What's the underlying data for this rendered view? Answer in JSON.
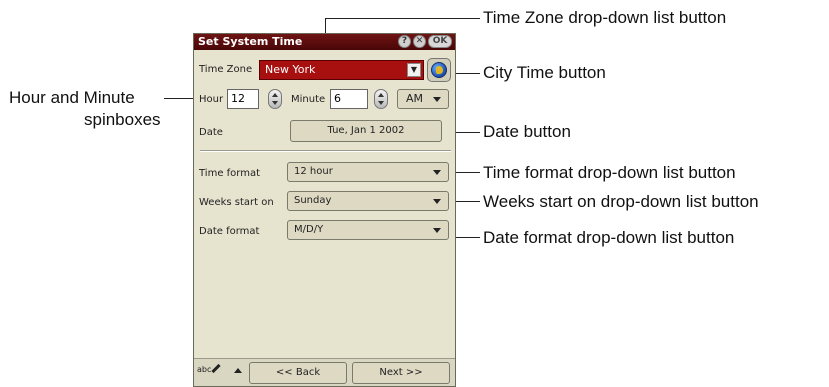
{
  "dialog": {
    "title": "Set System Time",
    "titlebar_help": "?",
    "titlebar_close": "✕",
    "titlebar_ok": "OK"
  },
  "fields": {
    "time_zone_label": "Time Zone",
    "time_zone_value": "New York",
    "hour_label": "Hour",
    "hour_value": "12",
    "minute_label": "Minute",
    "minute_value": "6",
    "ampm_value": "AM",
    "date_label": "Date",
    "date_value": "Tue, Jan 1 2002",
    "time_format_label": "Time format",
    "time_format_value": "12 hour",
    "weeks_start_label": "Weeks start on",
    "weeks_start_value": "Sunday",
    "date_format_label": "Date format",
    "date_format_value": "M/D/Y"
  },
  "bottom": {
    "pen_label": "abc",
    "back_label": "<< Back",
    "next_label": "Next >>"
  },
  "callouts": {
    "time_zone": "Time Zone drop-down list button",
    "city_time": "City Time button",
    "hour_minute_line1": "Hour and Minute",
    "hour_minute_line2": "spinboxes",
    "date_button": "Date button",
    "time_format": "Time format drop-down list button",
    "weeks_start": "Weeks start on drop-down list button",
    "date_format": "Date format drop-down list button"
  },
  "icons": {
    "globe": "globe-icon",
    "spinner": "spinner-icon",
    "dropdown": "chevron-down-icon",
    "pen": "pen-icon"
  }
}
